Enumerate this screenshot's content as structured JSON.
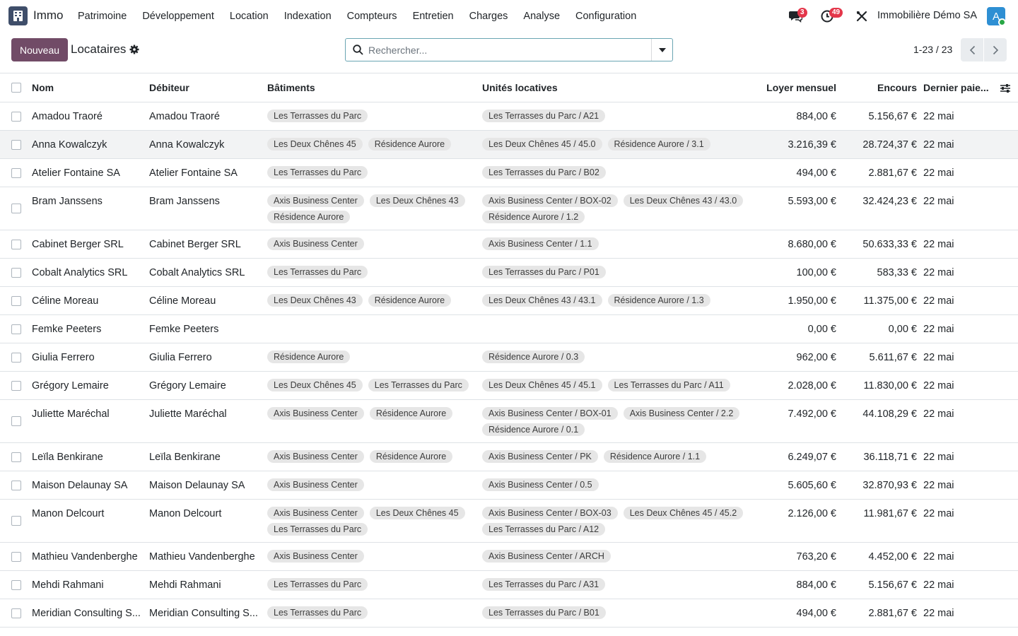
{
  "app": {
    "name": "Immo",
    "icon": "building-icon"
  },
  "menu": [
    "Patrimoine",
    "Développement",
    "Location",
    "Indexation",
    "Compteurs",
    "Entretien",
    "Charges",
    "Analyse",
    "Configuration"
  ],
  "systray": {
    "messages_count": "3",
    "activities_count": "49",
    "company": "Immobilière Démo SA",
    "avatar_letter": "A"
  },
  "control": {
    "new_label": "Nouveau",
    "title": "Locataires",
    "search_placeholder": "Rechercher...",
    "pager": "1-23 / 23"
  },
  "columns": {
    "name": "Nom",
    "debtor": "Débiteur",
    "buildings": "Bâtiments",
    "units": "Unités locatives",
    "rent": "Loyer mensuel",
    "balance": "Encours",
    "last_payment": "Dernier paie..."
  },
  "rows": [
    {
      "name": "Amadou Traoré",
      "debtor": "Amadou Traoré",
      "buildings": [
        "Les Terrasses du Parc"
      ],
      "units": [
        "Les Terrasses du Parc / A21"
      ],
      "rent": "884,00 €",
      "balance": "5.156,67 €",
      "last": "22 mai"
    },
    {
      "name": "Anna Kowalczyk",
      "debtor": "Anna Kowalczyk",
      "buildings": [
        "Les Deux Chênes 45",
        "Résidence Aurore"
      ],
      "units": [
        "Les Deux Chênes 45 / 45.0",
        "Résidence Aurore / 3.1"
      ],
      "rent": "3.216,39 €",
      "balance": "28.724,37 €",
      "last": "22 mai"
    },
    {
      "name": "Atelier Fontaine SA",
      "debtor": "Atelier Fontaine SA",
      "buildings": [
        "Les Terrasses du Parc"
      ],
      "units": [
        "Les Terrasses du Parc / B02"
      ],
      "rent": "494,00 €",
      "balance": "2.881,67 €",
      "last": "22 mai"
    },
    {
      "name": "Bram Janssens",
      "debtor": "Bram Janssens",
      "buildings": [
        "Axis Business Center",
        "Les Deux Chênes 43",
        "Résidence Aurore"
      ],
      "units": [
        "Axis Business Center / BOX-02",
        "Les Deux Chênes 43 / 43.0",
        "Résidence Aurore / 1.2"
      ],
      "rent": "5.593,00 €",
      "balance": "32.424,23 €",
      "last": "22 mai"
    },
    {
      "name": "Cabinet Berger SRL",
      "debtor": "Cabinet Berger SRL",
      "buildings": [
        "Axis Business Center"
      ],
      "units": [
        "Axis Business Center / 1.1"
      ],
      "rent": "8.680,00 €",
      "balance": "50.633,33 €",
      "last": "22 mai"
    },
    {
      "name": "Cobalt Analytics SRL",
      "debtor": "Cobalt Analytics SRL",
      "buildings": [
        "Les Terrasses du Parc"
      ],
      "units": [
        "Les Terrasses du Parc / P01"
      ],
      "rent": "100,00 €",
      "balance": "583,33 €",
      "last": "22 mai"
    },
    {
      "name": "Céline Moreau",
      "debtor": "Céline Moreau",
      "buildings": [
        "Les Deux Chênes 43",
        "Résidence Aurore"
      ],
      "units": [
        "Les Deux Chênes 43 / 43.1",
        "Résidence Aurore / 1.3"
      ],
      "rent": "1.950,00 €",
      "balance": "11.375,00 €",
      "last": "22 mai"
    },
    {
      "name": "Femke Peeters",
      "debtor": "Femke Peeters",
      "buildings": [],
      "units": [],
      "rent": "0,00 €",
      "balance": "0,00 €",
      "last": "22 mai"
    },
    {
      "name": "Giulia Ferrero",
      "debtor": "Giulia Ferrero",
      "buildings": [
        "Résidence Aurore"
      ],
      "units": [
        "Résidence Aurore / 0.3"
      ],
      "rent": "962,00 €",
      "balance": "5.611,67 €",
      "last": "22 mai"
    },
    {
      "name": "Grégory Lemaire",
      "debtor": "Grégory Lemaire",
      "buildings": [
        "Les Deux Chênes 45",
        "Les Terrasses du Parc"
      ],
      "units": [
        "Les Deux Chênes 45 / 45.1",
        "Les Terrasses du Parc / A11"
      ],
      "rent": "2.028,00 €",
      "balance": "11.830,00 €",
      "last": "22 mai"
    },
    {
      "name": "Juliette Maréchal",
      "debtor": "Juliette Maréchal",
      "buildings": [
        "Axis Business Center",
        "Résidence Aurore"
      ],
      "units": [
        "Axis Business Center / BOX-01",
        "Axis Business Center / 2.2",
        "Résidence Aurore / 0.1"
      ],
      "rent": "7.492,00 €",
      "balance": "44.108,29 €",
      "last": "22 mai"
    },
    {
      "name": "Leïla Benkirane",
      "debtor": "Leïla Benkirane",
      "buildings": [
        "Axis Business Center",
        "Résidence Aurore"
      ],
      "units": [
        "Axis Business Center / PK",
        "Résidence Aurore / 1.1"
      ],
      "rent": "6.249,07 €",
      "balance": "36.118,71 €",
      "last": "22 mai"
    },
    {
      "name": "Maison Delaunay SA",
      "debtor": "Maison Delaunay SA",
      "buildings": [
        "Axis Business Center"
      ],
      "units": [
        "Axis Business Center / 0.5"
      ],
      "rent": "5.605,60 €",
      "balance": "32.870,93 €",
      "last": "22 mai"
    },
    {
      "name": "Manon Delcourt",
      "debtor": "Manon Delcourt",
      "buildings": [
        "Axis Business Center",
        "Les Deux Chênes 45",
        "Les Terrasses du Parc"
      ],
      "units": [
        "Axis Business Center / BOX-03",
        "Les Deux Chênes 45 / 45.2",
        "Les Terrasses du Parc / A12"
      ],
      "rent": "2.126,00 €",
      "balance": "11.981,67 €",
      "last": "22 mai"
    },
    {
      "name": "Mathieu Vandenberghe",
      "debtor": "Mathieu Vandenberghe",
      "buildings": [
        "Axis Business Center"
      ],
      "units": [
        "Axis Business Center / ARCH"
      ],
      "rent": "763,20 €",
      "balance": "4.452,00 €",
      "last": "22 mai"
    },
    {
      "name": "Mehdi Rahmani",
      "debtor": "Mehdi Rahmani",
      "buildings": [
        "Les Terrasses du Parc"
      ],
      "units": [
        "Les Terrasses du Parc / A31"
      ],
      "rent": "884,00 €",
      "balance": "5.156,67 €",
      "last": "22 mai"
    },
    {
      "name": "Meridian Consulting S...",
      "debtor": "Meridian Consulting S...",
      "buildings": [
        "Les Terrasses du Parc"
      ],
      "units": [
        "Les Terrasses du Parc / B01"
      ],
      "rent": "494,00 €",
      "balance": "2.881,67 €",
      "last": "22 mai"
    }
  ],
  "colors": {
    "primary": "#714b67",
    "tag_bg": "#e6e6e6",
    "badge": "#e4364a",
    "avatar": "#2e8fd3",
    "hover_row": "#f2f3f4"
  }
}
